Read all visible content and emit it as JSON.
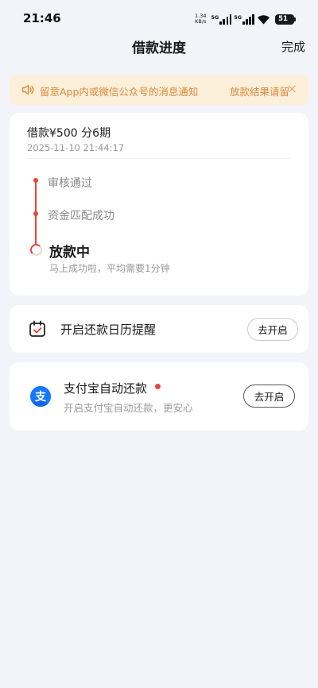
{
  "status_bar": {
    "time": "21:46",
    "net_speed_value": "1.34",
    "net_speed_unit": "KB/s",
    "network_1": "5G",
    "network_2": "5G",
    "battery": "51"
  },
  "nav": {
    "title": "借款进度",
    "done_label": "完成"
  },
  "notice": {
    "text": "留意App内或微信公众号的消息通知",
    "text_tail": "放款结果请留",
    "close": "×"
  },
  "progress_card": {
    "loan_summary": "借款¥500  分6期",
    "loan_time": "2025-11-10 21:44:17",
    "steps": [
      {
        "label": "审核通过",
        "status": "done"
      },
      {
        "label": "资金匹配成功",
        "status": "done"
      }
    ],
    "current_step": {
      "label": "放款中",
      "sub": "马上成功啦，平均需要1分钟"
    }
  },
  "calendar_card": {
    "label": "开启还款日历提醒",
    "button": "去开启"
  },
  "alipay_card": {
    "title": "支付宝自动还款",
    "subtitle": "开启支付宝自动还款，更安心",
    "button": "去开启",
    "icon_char": "支"
  },
  "colors": {
    "accent_red": "#E8443A",
    "notice_bg": "#FDF0DA",
    "notice_text": "#D9883B",
    "page_bg": "#F3F4F9",
    "alipay_blue": "#1677FF"
  },
  "icons": {
    "notice": "speaker-icon",
    "close": "close-icon",
    "calendar": "calendar-check-icon",
    "alipay": "alipay-logo-icon"
  }
}
